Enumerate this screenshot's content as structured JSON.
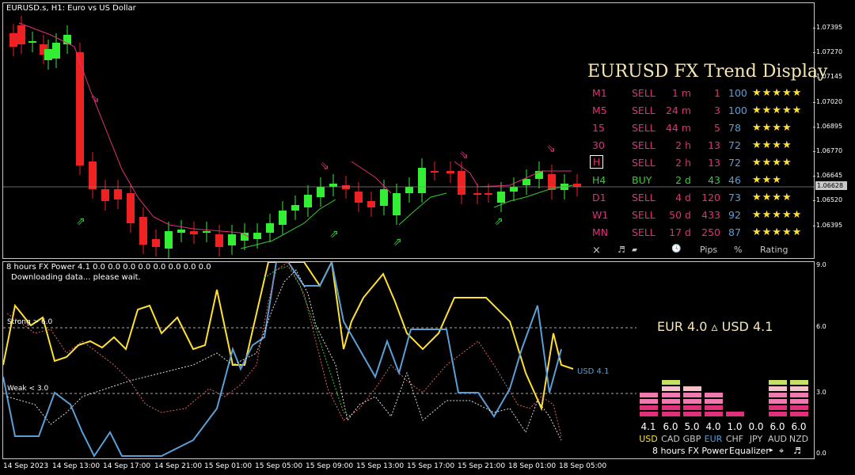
{
  "main": {
    "title": "EURUSD.s, H1:  Euro vs US Dollar",
    "current_price": "1.06628",
    "price_ticks": [
      "1.07395",
      "1.07270",
      "1.07145",
      "1.07020",
      "1.06895",
      "1.06770",
      "1.06645",
      "1.06520",
      "1.06395"
    ]
  },
  "trend_display": {
    "title": "EURUSD FX Trend Display",
    "rows": [
      {
        "tf": "M1",
        "signal": "SELL",
        "duration": "1 m",
        "pips": "1",
        "pct": "100",
        "stars": "★★★★★",
        "boxed": false
      },
      {
        "tf": "M5",
        "signal": "SELL",
        "duration": "24 m",
        "pips": "3",
        "pct": "100",
        "stars": "★★★★★",
        "boxed": false
      },
      {
        "tf": "15",
        "signal": "SELL",
        "duration": "44 m",
        "pips": "5",
        "pct": "78",
        "stars": "★★★★",
        "boxed": false
      },
      {
        "tf": "30",
        "signal": "SELL",
        "duration": "2 h",
        "pips": "13",
        "pct": "72",
        "stars": "★★★★",
        "boxed": false
      },
      {
        "tf": "H",
        "signal": "SELL",
        "duration": "2 h",
        "pips": "13",
        "pct": "72",
        "stars": "★★★★",
        "boxed": true
      },
      {
        "tf": "H4",
        "signal": "BUY",
        "duration": "2 d",
        "pips": "43",
        "pct": "46",
        "stars": "★★★",
        "boxed": false
      },
      {
        "tf": "D1",
        "signal": "SELL",
        "duration": "4 d",
        "pips": "120",
        "pct": "73",
        "stars": "★★★★",
        "boxed": false
      },
      {
        "tf": "W1",
        "signal": "SELL",
        "duration": "50 d",
        "pips": "433",
        "pct": "92",
        "stars": "★★★★★",
        "boxed": false
      },
      {
        "tf": "MN",
        "signal": "SELL",
        "duration": "17 d",
        "pips": "250",
        "pct": "87",
        "stars": "★★★★★",
        "boxed": false
      }
    ],
    "footer": {
      "close": "×",
      "sound": "♬",
      "wave": "▰",
      "clock": "🕓",
      "pips": "Pips",
      "pct": "%",
      "rating": "Rating"
    }
  },
  "sub": {
    "title": "8 hours FX Power 4.1 0.0 0.0 0.0 0.0 0.0 0.0 0.0 0.0",
    "message": "Downloading data... please wait.",
    "strong_label": "Strong > 6.0",
    "weak_label": "Weak < 3.0",
    "axis_ticks": [
      "9.0",
      "6.0",
      "3.0",
      "0.0"
    ],
    "usd_label": "USD 4.1",
    "strength_line": "EUR 4.0  ▵ USD 4.1"
  },
  "equalizer": {
    "values": [
      "4.1",
      "6.0",
      "5.0",
      "4.0",
      "1.0",
      "0.0",
      "6.0",
      "6.0"
    ],
    "currencies": [
      "USD",
      "CAD",
      "GBP",
      "EUR",
      "CHF",
      "JPY",
      "AUD",
      "NZD"
    ],
    "currency_colors": [
      "#ffe033",
      "#c8c8c8",
      "#c8c8c8",
      "#5a9fd6",
      "#c8c8c8",
      "#c8c8c8",
      "#c8c8c8",
      "#c8c8c8"
    ],
    "footer": {
      "period": "8 hours",
      "name": "FX Power",
      "mode": "Equalizer",
      "sep": "▸",
      "target": "⌖",
      "music": "♬"
    }
  },
  "time_axis": [
    "14 Sep 2023",
    "14 Sep 13:00",
    "14 Sep 17:00",
    "14 Sep 21:00",
    "15 Sep 01:00",
    "15 Sep 05:00",
    "15 Sep 09:00",
    "15 Sep 13:00",
    "15 Sep 17:00",
    "15 Sep 21:00",
    "18 Sep 01:00",
    "18 Sep 05:00"
  ],
  "colors": {
    "bull": "#33ee33",
    "bear": "#ee2222",
    "ma": "#e0307a",
    "support": "#33cc33",
    "usd": "#5a9fd6",
    "eur": "#ffe033",
    "sell": "#e0307a",
    "buy": "#33cc33"
  }
}
